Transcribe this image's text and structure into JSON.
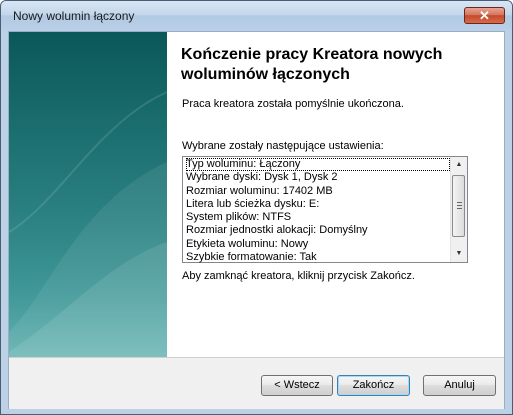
{
  "window": {
    "title": "Nowy wolumin łączony",
    "close_glyph": "✕"
  },
  "wizard": {
    "heading": "Kończenie pracy Kreatora nowych woluminów łączonych",
    "success_text": "Praca kreatora została pomyślnie ukończona.",
    "settings_intro": "Wybrane zostały następujące ustawienia:",
    "settings": [
      "Typ woluminu: Łączony",
      "Wybrane dyski: Dysk 1, Dysk 2",
      "Rozmiar woluminu: 17402 MB",
      "Litera lub ścieżka dysku: E:",
      "System plików: NTFS",
      "Rozmiar jednostki alokacji: Domyślny",
      "Etykieta woluminu: Nowy",
      "Szybkie formatowanie: Tak"
    ],
    "close_instruction": "Aby zamknąć kreatora, kliknij przycisk Zakończ."
  },
  "buttons": {
    "back": "< Wstecz",
    "finish": "Zakończ",
    "cancel": "Anuluj"
  },
  "icons": {
    "scroll_up": "▲",
    "scroll_down": "▼"
  }
}
